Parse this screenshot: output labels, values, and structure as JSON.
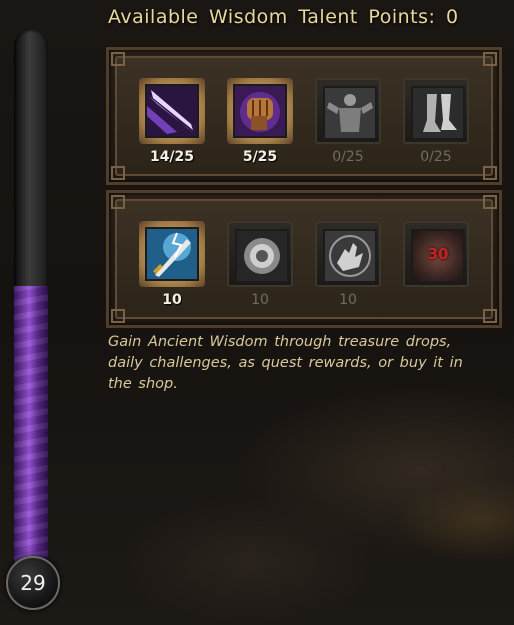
{
  "header": {
    "title": "Available Wisdom Talent Points: 0"
  },
  "level_bar": {
    "value": "29",
    "fill_fraction": 0.53
  },
  "talent_rows": [
    [
      {
        "icon": "blade-slash-icon",
        "points": "14/25",
        "active": true
      },
      {
        "icon": "power-fist-icon",
        "points": "5/25",
        "active": true
      },
      {
        "icon": "warrior-stance-icon",
        "points": "0/25",
        "active": false
      },
      {
        "icon": "leg-armor-icon",
        "points": "0/25",
        "active": false
      }
    ],
    [
      {
        "icon": "sword-lightning-icon",
        "points": "10",
        "active": true
      },
      {
        "icon": "swirl-orb-icon",
        "points": "10",
        "active": false
      },
      {
        "icon": "open-hand-icon",
        "points": "10",
        "active": false
      },
      {
        "icon": "locked-talent-icon",
        "points": "",
        "lock_level": "30",
        "active": false
      }
    ]
  ],
  "description": "Gain Ancient Wisdom through treasure drops, daily challenges, as quest rewards, or buy it in the shop.",
  "colors": {
    "title": "#e8d89a",
    "description": "#d8c89a",
    "bar_fill": "#9b55d8",
    "lock_text": "#cc2020"
  }
}
